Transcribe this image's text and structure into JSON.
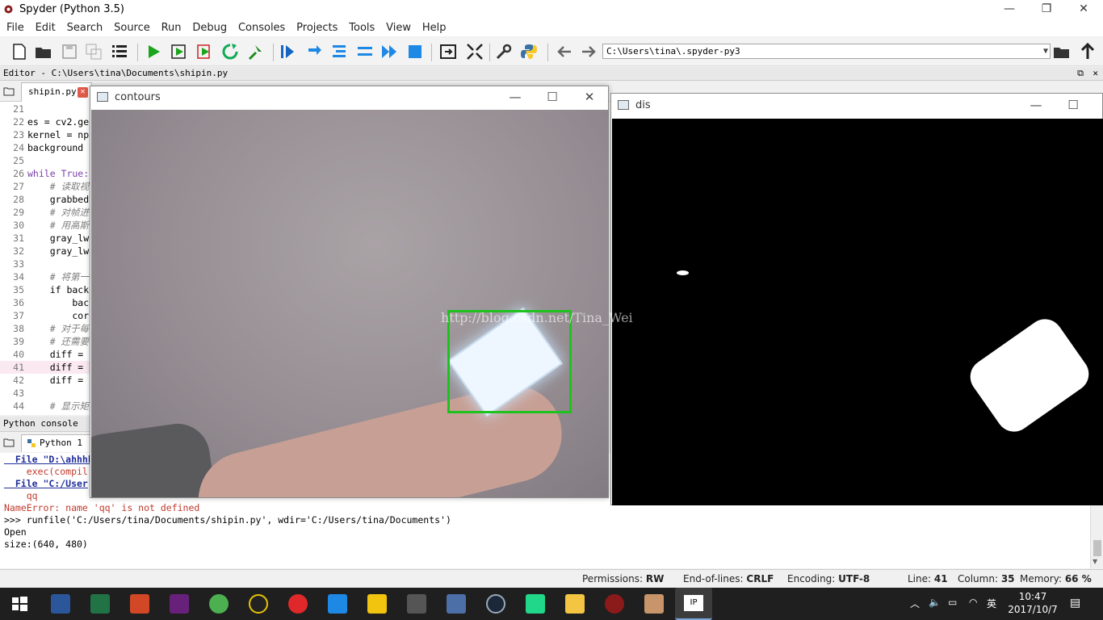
{
  "app": {
    "title": "Spyder (Python 3.5)"
  },
  "window_controls": {
    "minimize": "—",
    "restore": "❐",
    "close": "✕"
  },
  "menu": [
    "File",
    "Edit",
    "Search",
    "Source",
    "Run",
    "Debug",
    "Consoles",
    "Projects",
    "Tools",
    "View",
    "Help"
  ],
  "toolbar": {
    "path": "C:\\Users\\tina\\.spyder-py3",
    "icons": [
      "new-file-icon",
      "open-file-icon",
      "save-icon",
      "save-all-icon",
      "outline-icon",
      "run-icon",
      "run-cell-icon",
      "run-cell-advance-icon",
      "rerun-icon",
      "debug-icon",
      "debug-step-icon",
      "step-into-icon",
      "step-return-icon",
      "continue-icon",
      "stop-icon",
      "maximize-pane-icon",
      "fullscreen-icon",
      "wrench-icon",
      "python-icon",
      "back-icon",
      "forward-icon",
      "browse-folder-icon",
      "parent-dir-icon"
    ]
  },
  "editor": {
    "title": "Editor - C:\\Users\\tina\\Documents\\shipin.py",
    "tab": "shipin.py",
    "lines": [
      {
        "n": "21",
        "t": ""
      },
      {
        "n": "22",
        "t": "es = cv2.ge"
      },
      {
        "n": "23",
        "t": "kernel = np"
      },
      {
        "n": "24",
        "t": "background"
      },
      {
        "n": "25",
        "t": ""
      },
      {
        "n": "26",
        "kw": "while True:",
        "t": ""
      },
      {
        "n": "27",
        "c": "    # 读取视",
        "t": ""
      },
      {
        "n": "28",
        "t": "    grabbed"
      },
      {
        "n": "29",
        "c": "    # 对帧进",
        "t": ""
      },
      {
        "n": "30",
        "c": "    # 用高斯",
        "t": ""
      },
      {
        "n": "31",
        "t": "    gray_lw"
      },
      {
        "n": "32",
        "t": "    gray_lw"
      },
      {
        "n": "33",
        "t": ""
      },
      {
        "n": "34",
        "c": "    # 将第一",
        "t": ""
      },
      {
        "n": "35",
        "t": "    if back"
      },
      {
        "n": "36",
        "t": "        bac"
      },
      {
        "n": "37",
        "t": "        cor"
      },
      {
        "n": "38",
        "c": "    # 对于每",
        "t": ""
      },
      {
        "n": "39",
        "c": "    # 还需要",
        "t": ""
      },
      {
        "n": "40",
        "t": "    diff ="
      },
      {
        "n": "41",
        "t": "    diff =",
        "current": true
      },
      {
        "n": "42",
        "t": "    diff ="
      },
      {
        "n": "43",
        "t": ""
      },
      {
        "n": "44",
        "c": "    # 显示矩",
        "t": ""
      }
    ]
  },
  "console": {
    "title": "Python console",
    "tab": "Python 1",
    "lines": [
      {
        "cls": "link",
        "t": "  File \"D:\\ahhhh"
      },
      {
        "cls": "err",
        "t": "    exec(compil"
      },
      {
        "cls": "link",
        "t": "  File \"C:/User"
      },
      {
        "cls": "err",
        "t": "    qq"
      },
      {
        "cls": "err",
        "t": "NameError: name 'qq' is not defined"
      },
      {
        "cls": "",
        "t": ">>> runfile('C:/Users/tina/Documents/shipin.py', wdir='C:/Users/tina/Documents')"
      },
      {
        "cls": "",
        "t": "Open"
      },
      {
        "cls": "",
        "t": "size:(640, 480)"
      }
    ]
  },
  "statusbar": {
    "permissions_label": "Permissions:",
    "permissions": "RW",
    "eol_label": "End-of-lines:",
    "eol": "CRLF",
    "encoding_label": "Encoding:",
    "encoding": "UTF-8",
    "line_label": "Line:",
    "line": "41",
    "column_label": "Column:",
    "column": "35",
    "memory_label": "Memory:",
    "memory": "66 %"
  },
  "win_contours": {
    "title": "contours"
  },
  "win_dis": {
    "title": "dis"
  },
  "watermark": "http://blog.csdn.net/Tina_Wei",
  "taskbar": {
    "time": "10:47",
    "date": "2017/10/7",
    "ime": "英",
    "apps": [
      "start-icon",
      "word-icon",
      "excel-icon",
      "powerpoint-icon",
      "visual-studio-icon",
      "browser-icon",
      "qq-icon",
      "netease-music-icon",
      "feishu-icon",
      "yellow-app-icon",
      "xmind-icon",
      "vmware-icon",
      "steam-icon",
      "pycharm-icon",
      "file-explorer-icon",
      "spider-app-icon",
      "photo-app-icon",
      "ipython-icon"
    ],
    "colors": {
      "bg": "#1f1f1f",
      "active": "#3c3c3c"
    }
  }
}
